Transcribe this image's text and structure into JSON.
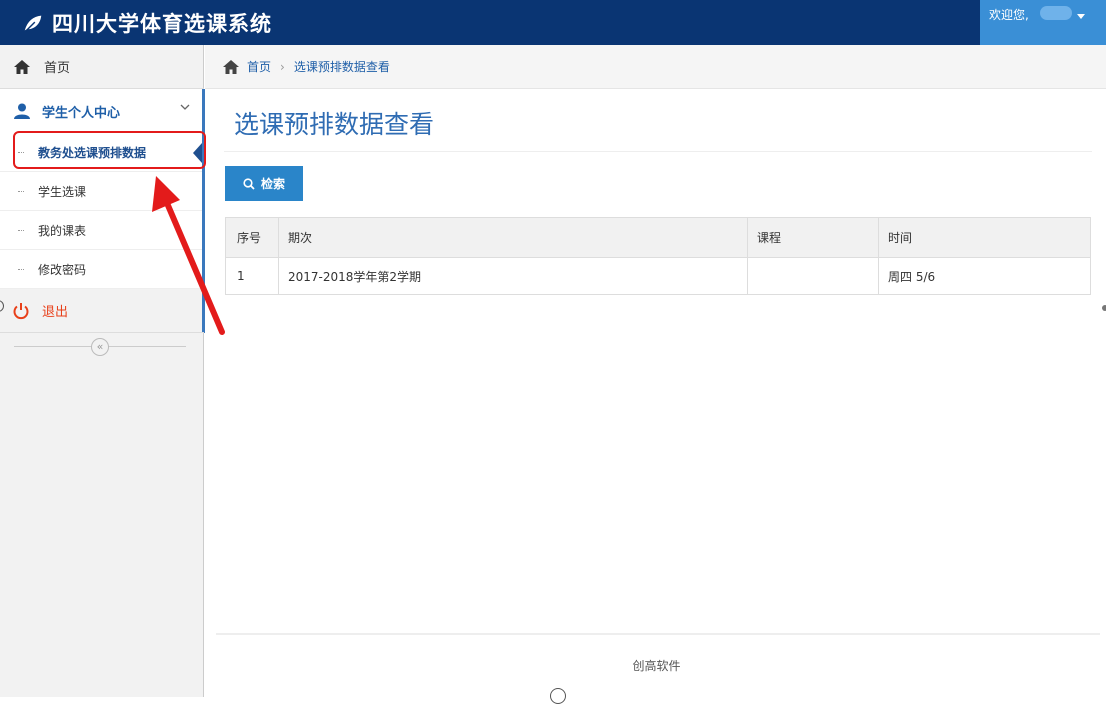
{
  "header": {
    "title": "四川大学体育选课系统",
    "welcome": "欢迎您,"
  },
  "sidebar": {
    "home": "首页",
    "center": "学生个人中心",
    "items": [
      {
        "label": "教务处选课预排数据",
        "active": true
      },
      {
        "label": "学生选课"
      },
      {
        "label": "我的课表"
      },
      {
        "label": "修改密码"
      }
    ],
    "logout": "退出",
    "collapse_glyph": "«"
  },
  "breadcrumb": {
    "home": "首页",
    "current": "选课预排数据查看"
  },
  "main": {
    "title": "选课预排数据查看",
    "search_button": "检索",
    "table": {
      "headers": [
        "序号",
        "期次",
        "课程",
        "时间"
      ],
      "rows": [
        [
          "1",
          "2017-2018学年第2学期",
          "",
          "周四 5/6"
        ]
      ]
    }
  },
  "footer": {
    "text": "创高软件"
  },
  "colors": {
    "topbar": "#0a3573",
    "accent": "#2a85c9",
    "highlight": "#e31b1b"
  }
}
